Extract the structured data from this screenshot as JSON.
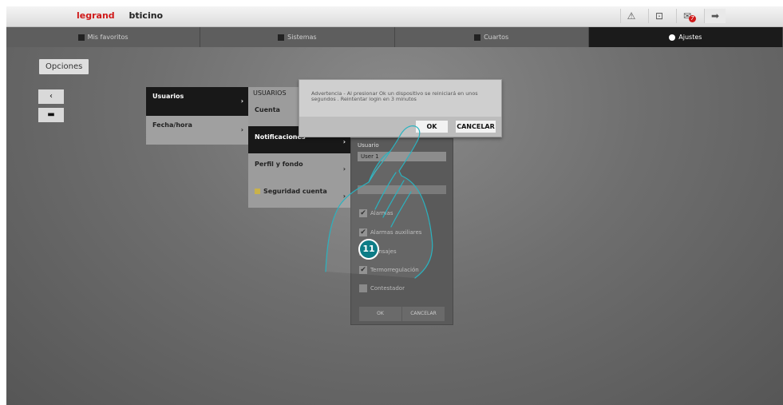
{
  "brand": {
    "legrand": "legrand",
    "bticino": "bticino"
  },
  "top_icons": [
    "warning-icon",
    "lock-icon",
    "mail-icon",
    "exit-icon"
  ],
  "notification_count": "7",
  "nav_tabs": [
    {
      "label": "Mis favoritos",
      "icon": "star-icon"
    },
    {
      "label": "Sistemas",
      "icon": "system-icon"
    },
    {
      "label": "Cuartos",
      "icon": "room-icon"
    },
    {
      "label": "Ajustes",
      "icon": "settings-icon",
      "active": true
    }
  ],
  "page_title": "Opciones",
  "side_buttons": {
    "back": "‹",
    "save": "▬"
  },
  "menu_level1": [
    {
      "label": "Usuarios"
    },
    {
      "label": "Fecha/hora"
    }
  ],
  "menu_level2": {
    "header": "USUARIOS",
    "items": [
      {
        "label": "Cuenta"
      },
      {
        "label": "Notificaciones"
      },
      {
        "label": "Perfil y fondo"
      },
      {
        "label": "Seguridad cuenta"
      }
    ]
  },
  "notif_panel": {
    "user_label": "Usuario",
    "user_value": "User 1",
    "options": [
      {
        "label": "Alarmas",
        "checked": true
      },
      {
        "label": "Alarmas auxiliares",
        "checked": true
      },
      {
        "label": "Mensajes",
        "checked": true
      },
      {
        "label": "Termorregulación",
        "checked": true
      },
      {
        "label": "Contestador",
        "checked": false
      }
    ],
    "ok": "OK",
    "cancel": "CANCELAR"
  },
  "dialog": {
    "message": "Advertencia - Al presionar Ok un dispositivo se reiniciará en unos segundos . Reintentar login en 3 minutos",
    "ok": "OK",
    "cancel": "CANCELAR"
  },
  "step_number": "11",
  "colors": {
    "accent": "#0d7c86",
    "brand_red": "#d01a1a",
    "active_tab": "#1b1b1b"
  }
}
